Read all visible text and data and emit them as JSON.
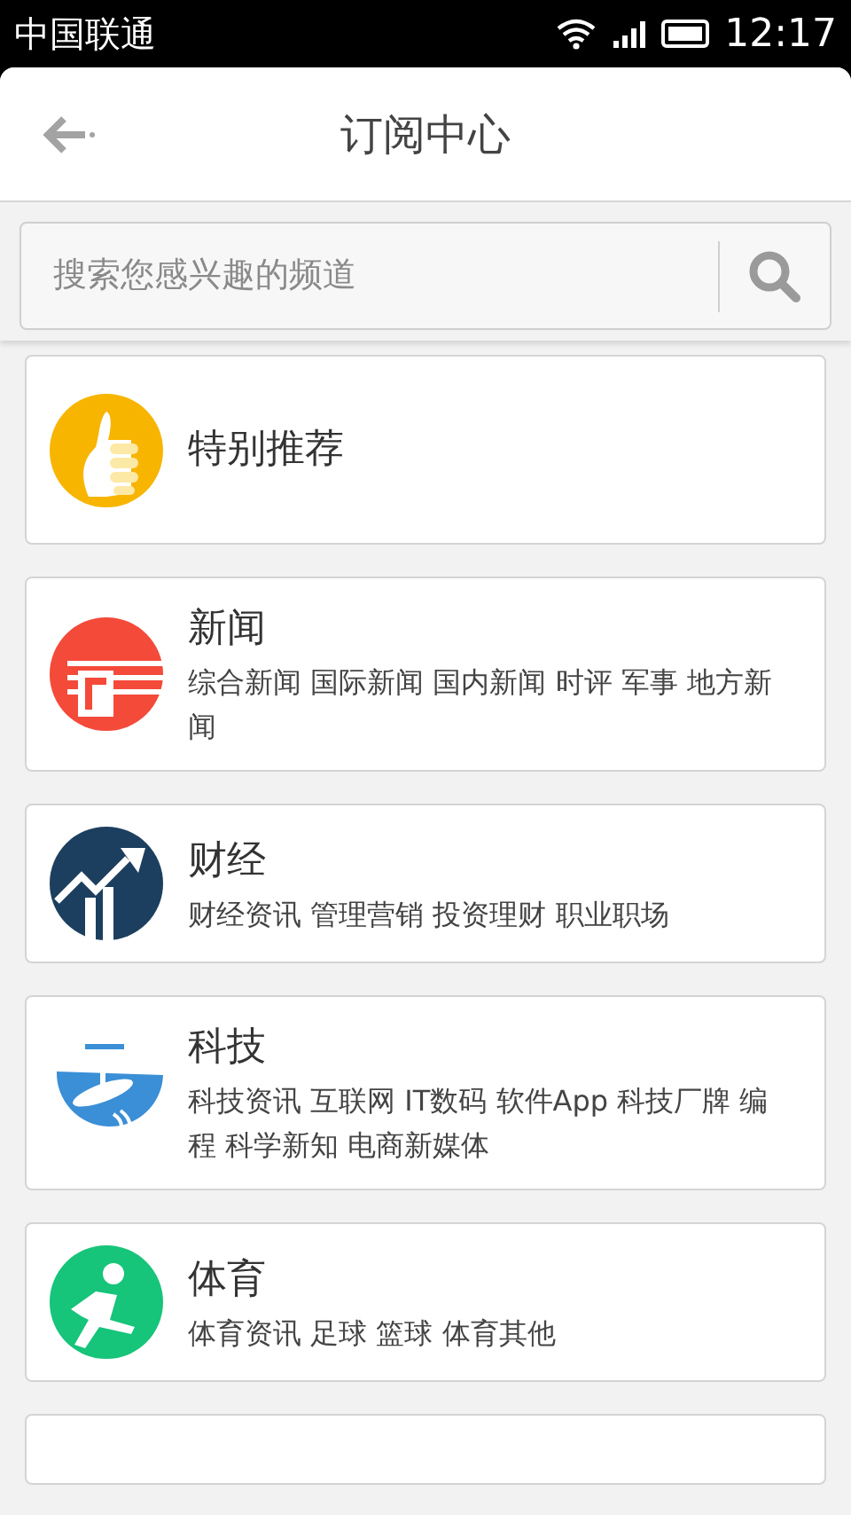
{
  "status_bar": {
    "carrier": "中国联通",
    "time": "12:17"
  },
  "header": {
    "title": "订阅中心"
  },
  "search": {
    "placeholder": "搜索您感兴趣的频道"
  },
  "categories": [
    {
      "kind": "thumb",
      "name": "特别推荐"
    },
    {
      "kind": "news",
      "name": "新闻",
      "tags": "综合新闻 国际新闻 国内新闻 时评 军事 地方新闻"
    },
    {
      "kind": "finance",
      "name": "财经",
      "tags": "财经资讯 管理营销 投资理财 职业职场"
    },
    {
      "kind": "tech",
      "name": "科技",
      "tags": "科技资讯 互联网 IT数码 软件App 科技厂牌 编程 科学新知 电商新媒体"
    },
    {
      "kind": "sports",
      "name": "体育",
      "tags": "体育资讯 足球 篮球 体育其他"
    }
  ]
}
